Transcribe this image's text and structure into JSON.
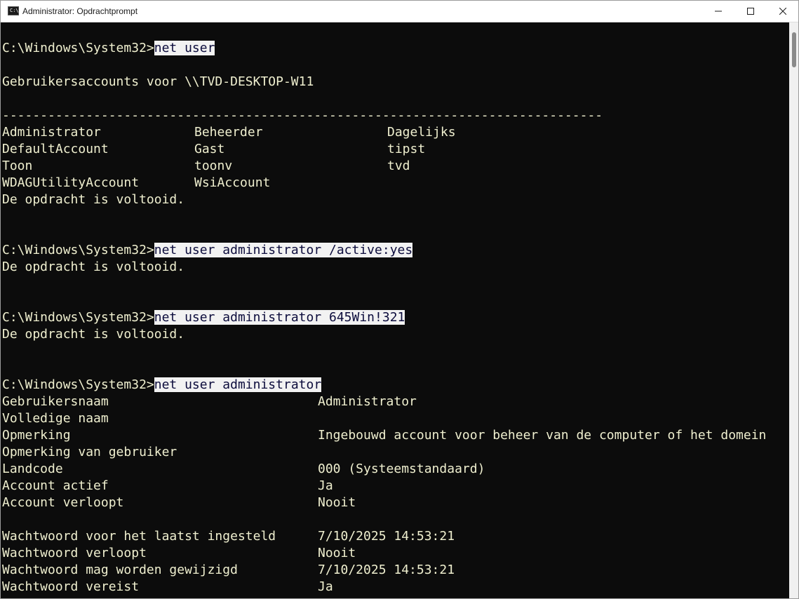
{
  "window": {
    "title": "Administrator: Opdrachtprompt",
    "icon": "cmd-icon",
    "controls": [
      "minimize-icon",
      "maximize-icon",
      "close-icon"
    ]
  },
  "console": {
    "prompt": "C:\\Windows\\System32>",
    "cmd1": "net user",
    "accounts_header": "Gebruikersaccounts voor \\\\TVD-DESKTOP-W11",
    "separator": "-------------------------------------------------------------------------------",
    "users": [
      [
        "Administrator",
        "Beheerder",
        "Dagelijks"
      ],
      [
        "DefaultAccount",
        "Gast",
        "tipst"
      ],
      [
        "Toon",
        "toonv",
        "tvd"
      ],
      [
        "WDAGUtilityAccount",
        "WsiAccount",
        ""
      ]
    ],
    "done": "De opdracht is voltooid.",
    "cmd2": "net user administrator /active:yes",
    "cmd3": "net user administrator 645Win!321",
    "cmd4": "net user administrator",
    "details": [
      [
        "Gebruikersnaam",
        "Administrator"
      ],
      [
        "Volledige naam",
        ""
      ],
      [
        "Opmerking",
        "Ingebouwd account voor beheer van de computer of het domein"
      ],
      [
        "Opmerking van gebruiker",
        ""
      ],
      [
        "Landcode",
        "000 (Systeemstandaard)"
      ],
      [
        "Account actief",
        "Ja"
      ],
      [
        "Account verloopt",
        "Nooit"
      ],
      [
        "",
        ""
      ],
      [
        "Wachtwoord voor het laatst ingesteld",
        "7/10/2025 14:53:21"
      ],
      [
        "Wachtwoord verloopt",
        "Nooit"
      ],
      [
        "Wachtwoord mag worden gewijzigd",
        "7/10/2025 14:53:21"
      ],
      [
        "Wachtwoord vereist",
        "Ja"
      ]
    ]
  },
  "colors": {
    "background": "#0c0c0c",
    "text": "#efefcf",
    "selection_bg": "#f2f2f2",
    "selection_text": "#0c0c3c"
  }
}
